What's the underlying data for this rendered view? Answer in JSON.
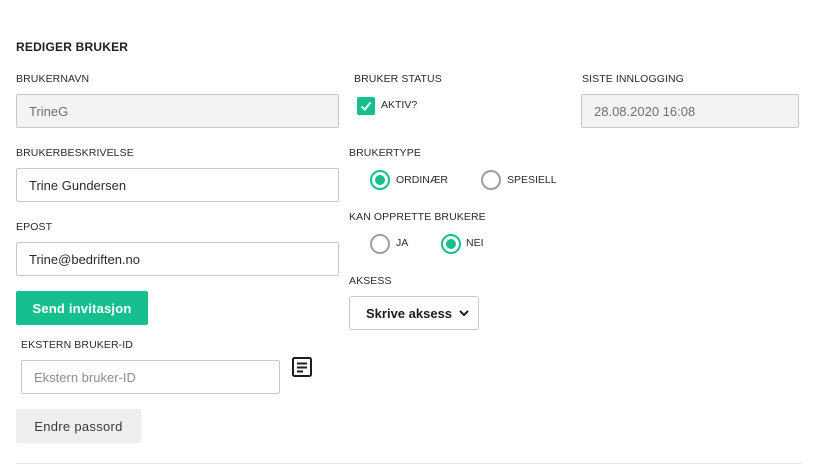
{
  "form": {
    "title": "REDIGER BRUKER",
    "username": {
      "label": "BRUKERNAVN",
      "value": "TrineG"
    },
    "description": {
      "label": "BRUKERBESKRIVELSE",
      "value": "Trine Gundersen"
    },
    "email": {
      "label": "EPOST",
      "value": "Trine@bedriften.no"
    },
    "send_invite_label": "Send invitasjon",
    "external_id": {
      "label": "EKSTERN BRUKER-ID",
      "value": "",
      "placeholder": "Ekstern bruker-ID"
    },
    "change_password_label": "Endre passord",
    "status": {
      "label": "BRUKER STATUS",
      "checkbox_label": "AKTIV?",
      "checked": true
    },
    "user_type": {
      "label": "BRUKERTYPE",
      "options": [
        {
          "label": "ORDINÆR",
          "selected": true
        },
        {
          "label": "SPESIELL",
          "selected": false
        }
      ]
    },
    "can_create_users": {
      "label": "KAN OPPRETTE BRUKERE",
      "options": [
        {
          "label": "JA",
          "selected": false
        },
        {
          "label": "NEI",
          "selected": true
        }
      ]
    },
    "access": {
      "label": "AKSESS",
      "value": "Skrive aksess"
    },
    "last_login": {
      "label": "SISTE INNLOGGING",
      "value": "28.08.2020 16:08"
    }
  },
  "colors": {
    "accent": "#15bf8e",
    "readonly_bg": "#f3f3f3",
    "border": "#c8c8c8"
  },
  "icons": {
    "external_id_action": "document-lines-icon",
    "checkbox": "checkmark-icon",
    "select": "chevron-down-icon"
  }
}
